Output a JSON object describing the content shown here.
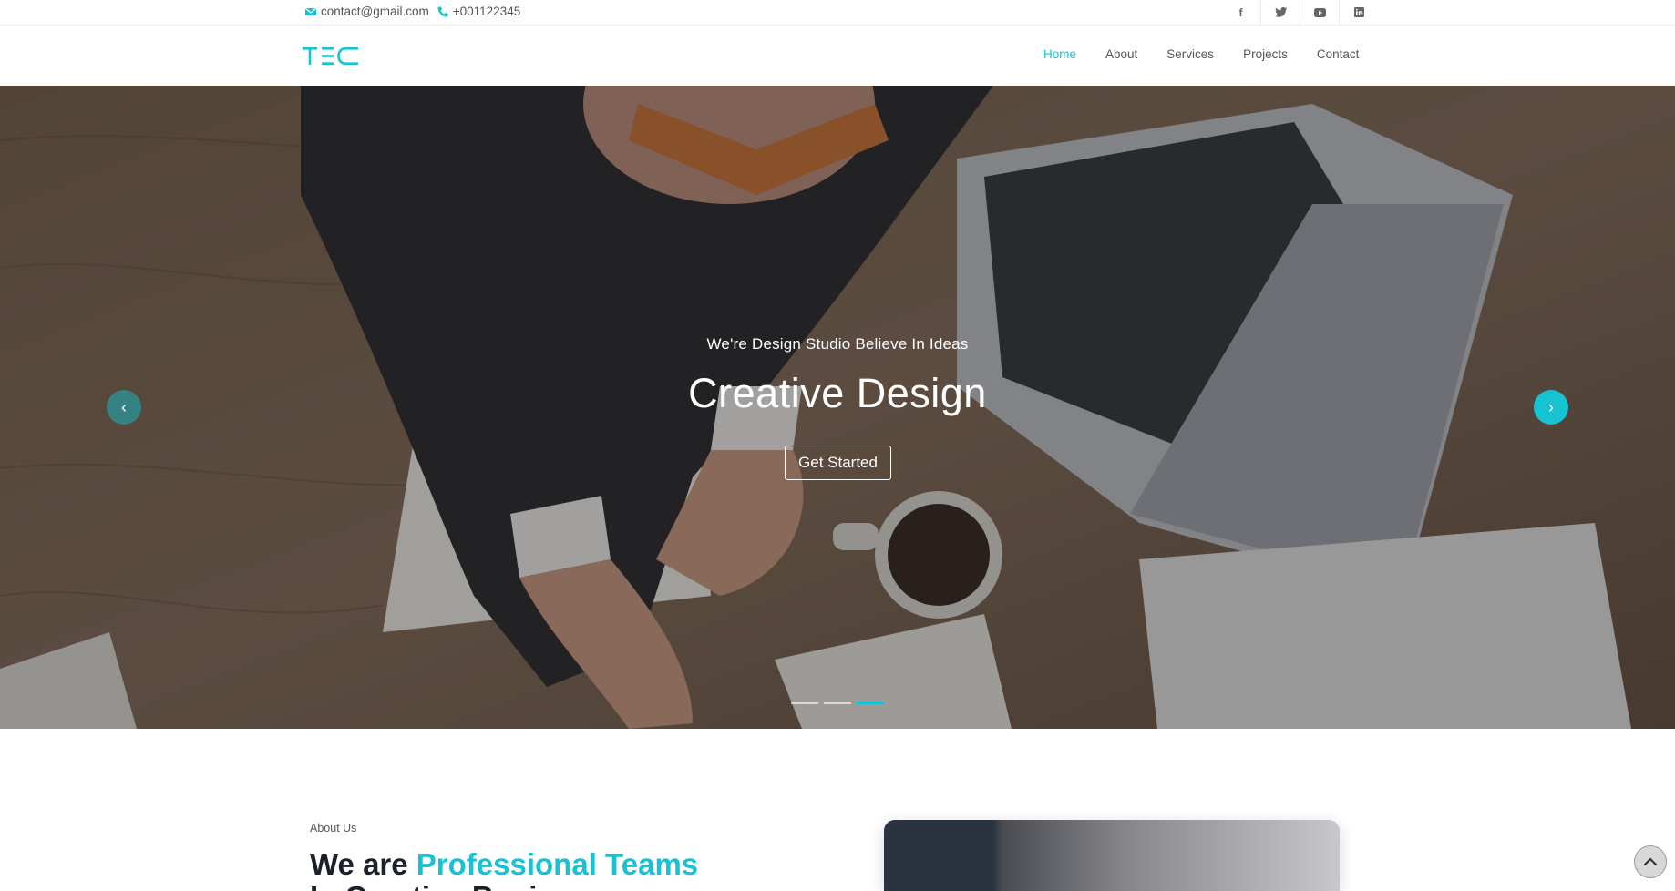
{
  "topbar": {
    "email": "contact@gmail.com",
    "phone": "+001122345",
    "socials": [
      {
        "icon": "facebook-icon",
        "glyph": "f"
      },
      {
        "icon": "twitter-icon",
        "glyph": "t"
      },
      {
        "icon": "youtube-icon",
        "glyph": "▶"
      },
      {
        "icon": "linkedin-icon",
        "glyph": "in"
      }
    ]
  },
  "navbar": {
    "logo": "TEC",
    "items": [
      {
        "label": "Home",
        "active": true
      },
      {
        "label": "About",
        "active": false
      },
      {
        "label": "Services",
        "active": false
      },
      {
        "label": "Projects",
        "active": false
      },
      {
        "label": "Contact",
        "active": false
      }
    ]
  },
  "hero": {
    "subtitle": "We're Design Studio Believe In Ideas",
    "title": "Creative Design",
    "cta_label": "Get Started",
    "prev_icon": "‹",
    "next_icon": "›",
    "active_slide": 3,
    "slide_count": 3
  },
  "about": {
    "label": "About Us",
    "heading_prefix": "We are ",
    "heading_highlight": "Professional Teams",
    "heading_line2": "In Creative Business"
  },
  "colors": {
    "accent": "#17c3d3",
    "heading": "#1b1f2b",
    "text": "#555555"
  },
  "icons": {
    "email": "envelope-icon",
    "phone": "phone-icon",
    "scroll_top": "chevron-up-icon"
  }
}
